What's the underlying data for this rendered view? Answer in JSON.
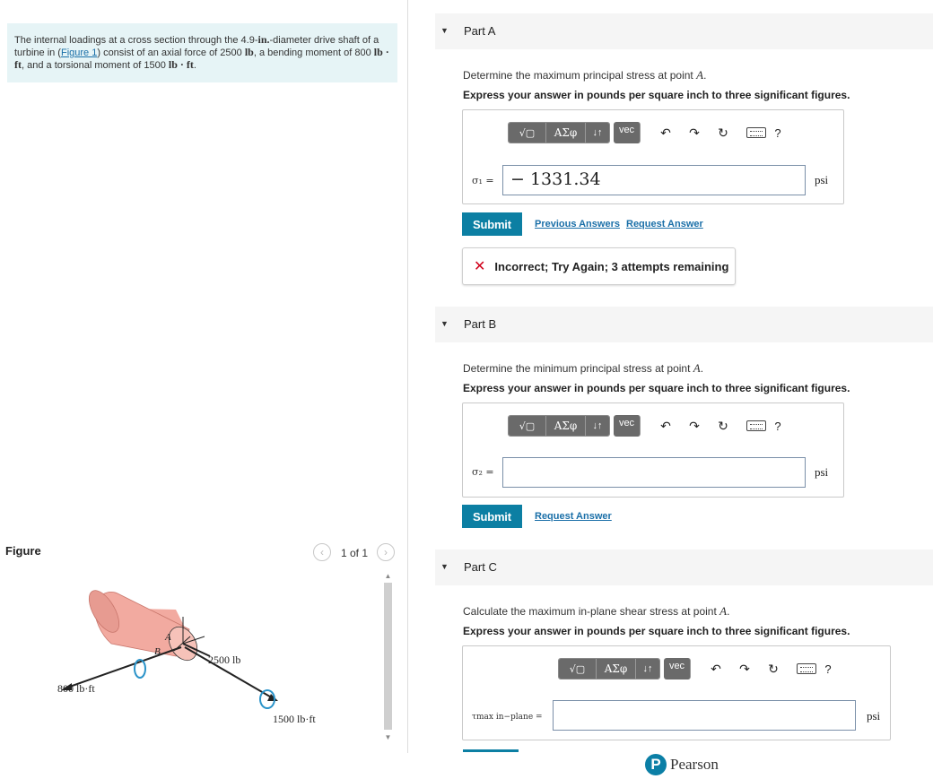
{
  "problem": {
    "text_1": "The internal loadings at a cross section through the 4.9-",
    "unit_in": "in.",
    "text_2": "-diameter drive shaft of a turbine in (",
    "figure_link": "Figure 1",
    "text_3": ") consist of an axial force of 2500 ",
    "unit_lb": "lb",
    "text_4": ", a bending moment of 800 ",
    "unit_lbft_1": "lb · ft",
    "text_5": ", and a torsional moment of 1500 ",
    "unit_lbft_2": "lb · ft",
    "text_6": "."
  },
  "figure": {
    "label": "Figure",
    "pager": "1 of 1",
    "prev_icon": "chevron-left-icon",
    "next_icon": "chevron-right-icon",
    "labels": {
      "point_a": "A",
      "point_b": "B",
      "axial_force": "2500 lb",
      "bending_moment": "800 lb·ft",
      "torsional_moment": "1500 lb·ft"
    },
    "colors": {
      "shaft": "#f2aaa0",
      "shaft_dark": "#e08c82",
      "arrow": "#2a93c9"
    }
  },
  "toolbar": {
    "sqrt_label": "√▢",
    "greek_label": "ΑΣφ",
    "arrows_label": "↓↑",
    "vec_label": "vec",
    "undo_icon": "undo-icon",
    "redo_icon": "redo-icon",
    "reset_icon": "reset-icon",
    "keyboard_icon": "keyboard-icon",
    "help_label": "?"
  },
  "parts": {
    "a": {
      "title": "Part A",
      "question_1": "Determine the maximum principal stress at point ",
      "question_point": "A",
      "question_end": ".",
      "instruction": "Express your answer in pounds per square inch to three significant figures.",
      "var_label": "σ₁ =",
      "value": "− 1331.34",
      "unit": "psi",
      "submit": "Submit",
      "previous_answers": "Previous Answers",
      "request_answer": "Request Answer",
      "feedback": "Incorrect; Try Again; 3 attempts remaining"
    },
    "b": {
      "title": "Part B",
      "question_1": "Determine the minimum principal stress at point ",
      "question_point": "A",
      "question_end": ".",
      "instruction": "Express your answer in pounds per square inch to three significant figures.",
      "var_label": "σ₂ =",
      "value": "",
      "unit": "psi",
      "submit": "Submit",
      "request_answer": "Request Answer"
    },
    "c": {
      "title": "Part C",
      "question_1": "Calculate the maximum in-plane shear stress at point ",
      "question_point": "A",
      "question_end": ".",
      "instruction": "Express your answer in pounds per square inch to three significant figures.",
      "var_label": "τmax in−plane =",
      "value": "",
      "unit": "psi"
    }
  },
  "footer": {
    "logo_letter": "P",
    "brand": "Pearson"
  },
  "colors": {
    "accent": "#0c7fa3",
    "error": "#d0021b",
    "problem_bg": "#e6f4f6"
  }
}
